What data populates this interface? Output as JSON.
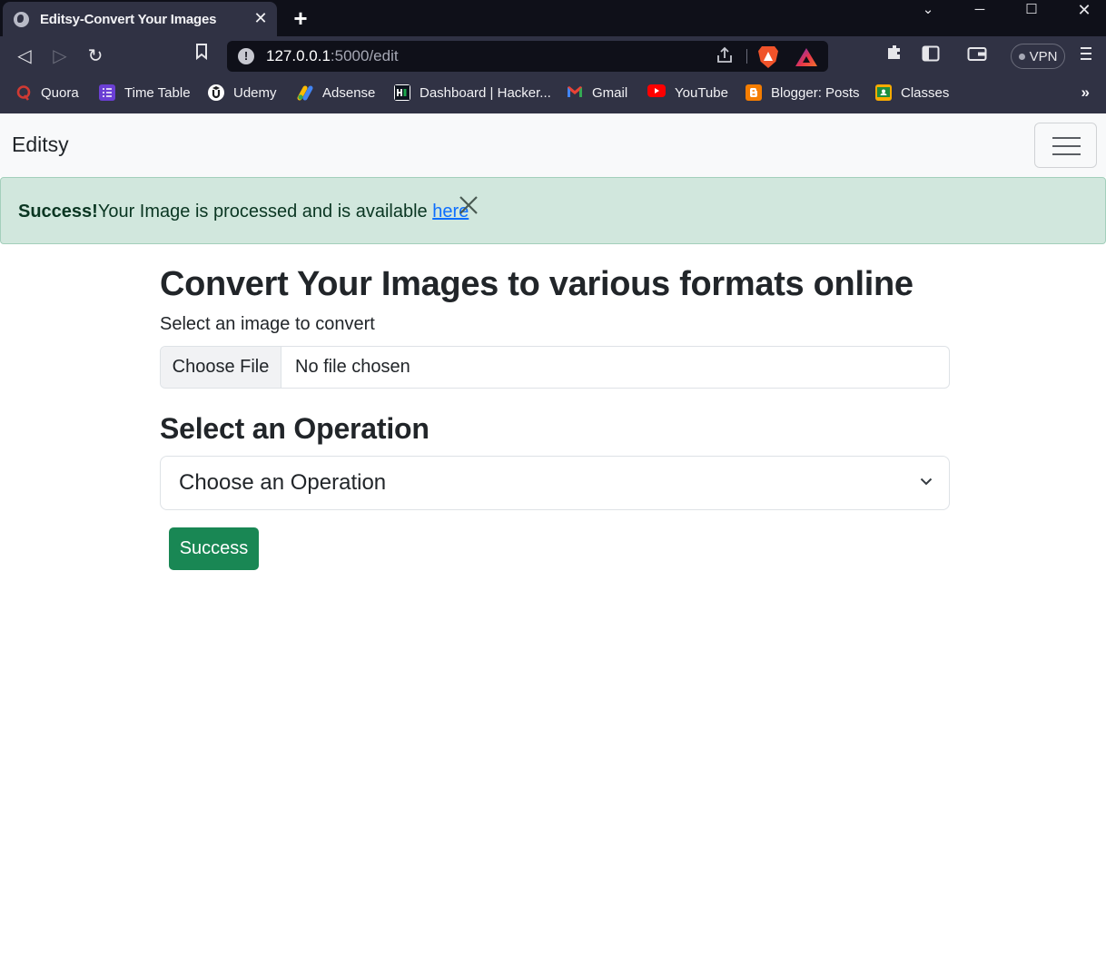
{
  "browser": {
    "tab_title": "Editsy-Convert Your Images",
    "tab_close": "✕",
    "new_tab": "+",
    "window_controls": {
      "tab_search": "⌄",
      "minimize": "─",
      "maximize": "☐",
      "close": "✕"
    },
    "toolbar": {
      "back": "◁",
      "forward": "▷",
      "reload": "↻",
      "bookmark": "🔖"
    },
    "url_host": "127.0.0.1",
    "url_rest": ":5000/edit",
    "vpn_label": "VPN",
    "bookmarks": [
      {
        "label": "Quora",
        "icon": "quora-icon",
        "color": "#b92b27"
      },
      {
        "label": "Time Table",
        "icon": "timetable-icon",
        "color": "#6b3fd4"
      },
      {
        "label": "Udemy",
        "icon": "udemy-icon",
        "color": "#ffffff"
      },
      {
        "label": "Adsense",
        "icon": "adsense-icon",
        "color": "#fbbc04"
      },
      {
        "label": "Dashboard | Hacker...",
        "icon": "hackerrank-icon",
        "color": "#0e141e"
      },
      {
        "label": "Gmail",
        "icon": "gmail-icon",
        "color": "#ea4335"
      },
      {
        "label": "YouTube",
        "icon": "youtube-icon",
        "color": "#ff0000"
      },
      {
        "label": "Blogger: Posts",
        "icon": "blogger-icon",
        "color": "#f57d00"
      },
      {
        "label": "Classes",
        "icon": "classroom-icon",
        "color": "#f9ab00"
      }
    ],
    "bookmarks_more": "»"
  },
  "navbar": {
    "brand": "Editsy"
  },
  "alert": {
    "strong": "Success!",
    "message": "Your Image is processed and is available ",
    "link": "here",
    "close": "✕"
  },
  "form": {
    "heading": "Convert Your Images to various formats online",
    "file_label": "Select an image to convert",
    "file_button": "Choose File",
    "file_status": "No file chosen",
    "operation_heading": "Select an Operation",
    "operation_selected": "Choose an Operation",
    "submit_label": "Success"
  },
  "colors": {
    "success": "#198754",
    "alert_bg": "#d1e7dd",
    "link": "#0d6efd"
  }
}
